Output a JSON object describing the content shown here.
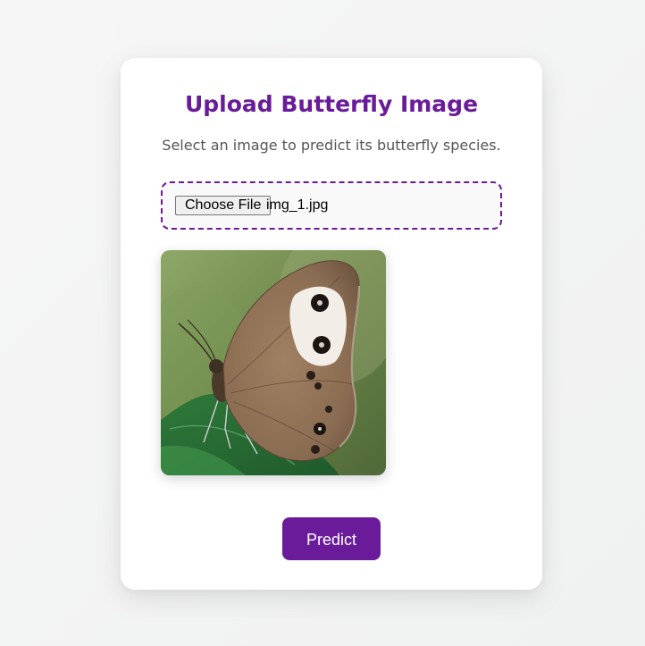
{
  "card": {
    "title": "Upload Butterfly Image",
    "subtitle": "Select an image to predict its butterfly species."
  },
  "file_input": {
    "button_label": "Choose File",
    "file_name": "img_1.jpg"
  },
  "preview": {
    "icon": "butterfly-photo"
  },
  "predict_button": {
    "label": "Predict"
  },
  "colors": {
    "accent": "#6a1b9a",
    "background": "#f3f3f3",
    "card": "#ffffff",
    "subtitle": "#555555"
  }
}
